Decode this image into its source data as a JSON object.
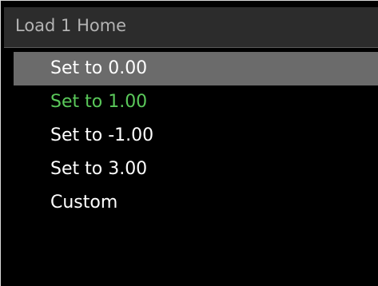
{
  "header": {
    "title": "Load 1 Home"
  },
  "menu": {
    "items": [
      {
        "label": "Set to 0.00",
        "state": "highlighted"
      },
      {
        "label": "Set to 1.00",
        "state": "current"
      },
      {
        "label": "Set to -1.00",
        "state": "normal"
      },
      {
        "label": "Set to 3.00",
        "state": "normal"
      },
      {
        "label": "Custom",
        "state": "normal"
      }
    ]
  },
  "colors": {
    "background": "#000000",
    "title_bar": "#2c2c2c",
    "title_text": "#b4b4b4",
    "highlight": "#6b6b6b",
    "current_value": "#5ac85a",
    "item_text": "#ffffff"
  }
}
